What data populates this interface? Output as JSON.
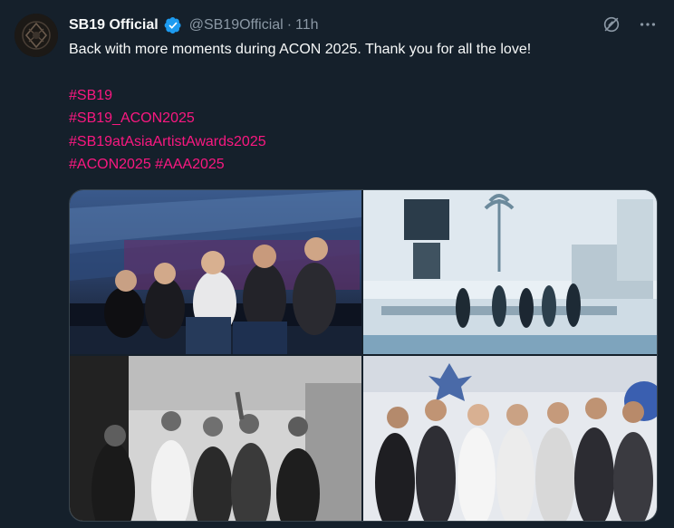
{
  "tweet": {
    "display_name": "SB19 Official",
    "verified_icon": "verified-badge-icon",
    "handle": "@SB19Official",
    "separator": "·",
    "time": "11h",
    "text": "Back with more moments during ACON 2025. Thank you for all the love!",
    "hashtags": [
      "#SB19",
      "#SB19_ACON2025",
      "#SB19atAsiaArtistAwards2025",
      "#ACON2025",
      "#AAA2025"
    ],
    "media": [
      {
        "alt_icon": "photo-group-seated-stadium"
      },
      {
        "alt_icon": "photo-stage-rehearsal"
      },
      {
        "alt_icon": "photo-group-bw-backstage"
      },
      {
        "alt_icon": "photo-group-posing-balloons"
      }
    ]
  },
  "colors": {
    "background": "#15202b",
    "text": "#f7f9f9",
    "muted": "#8b98a5",
    "hashtag": "#f91880",
    "verified": "#1d9bf0"
  },
  "icons": {
    "grok": "grok-icon",
    "more": "more-icon"
  }
}
